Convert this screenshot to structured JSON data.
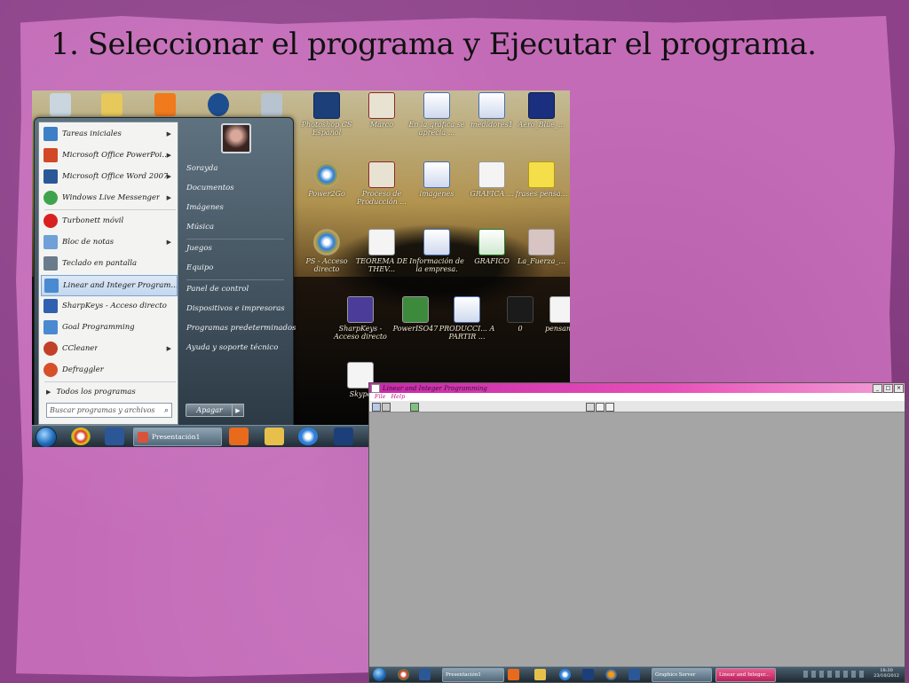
{
  "slide": {
    "title": "1. Seleccionar el programa y Ejecutar el programa."
  },
  "desktop_icons": [
    {
      "label": "Photoshop CS Español",
      "icon": "photoshop-icon"
    },
    {
      "label": "Marco",
      "icon": "pdf-icon"
    },
    {
      "label": "En la gráfica se aprecia ...",
      "icon": "word-doc-icon"
    },
    {
      "label": "medidores1",
      "icon": "word-doc-icon"
    },
    {
      "label": "Aero_Blue_...",
      "icon": "image-icon"
    },
    {
      "label": "Power2Go",
      "icon": "cd-icon"
    },
    {
      "label": "Proceso de Producción ...",
      "icon": "pdf-icon"
    },
    {
      "label": "imagenes",
      "icon": "word-doc-icon"
    },
    {
      "label": "GRAFICA ...",
      "icon": "document-icon"
    },
    {
      "label": "frases pensa...",
      "icon": "note-icon"
    },
    {
      "label": "PS - Acceso directo",
      "icon": "shortcut-icon"
    },
    {
      "label": "TEOREMA DE THEV...",
      "icon": "document-icon"
    },
    {
      "label": "Información de la empresa.",
      "icon": "word-doc-icon"
    },
    {
      "label": "GRAFICO",
      "icon": "excel-icon"
    },
    {
      "label": "La_Fuerza_...",
      "icon": "image-icon"
    },
    {
      "label": "SharpKeys - Acceso directo",
      "icon": "shortcut-icon"
    },
    {
      "label": "PowerISO47",
      "icon": "installer-icon"
    },
    {
      "label": "PRODUCCI... A PARTIR ...",
      "icon": "word-doc-icon"
    },
    {
      "label": "0",
      "icon": "document-icon"
    },
    {
      "label": "pensamientos...",
      "icon": "note-icon"
    },
    {
      "label": "Skype",
      "icon": "document-icon"
    }
  ],
  "start_menu": {
    "programs": [
      {
        "label": "Tareas iniciales",
        "has_submenu": true,
        "color": "#3f7fc6"
      },
      {
        "label": "Microsoft Office PowerPoi...",
        "has_submenu": true,
        "color": "#d24726"
      },
      {
        "label": "Microsoft Office Word 2007",
        "has_submenu": true,
        "color": "#2b5797"
      },
      {
        "label": "Windows Live Messenger",
        "has_submenu": true,
        "color": "#3fa34d"
      },
      {
        "label": "Turbonett móvil",
        "has_submenu": false,
        "color": "#d92020"
      },
      {
        "label": "Bloc de notas",
        "has_submenu": true,
        "color": "#6fa0d8"
      },
      {
        "label": "Teclado en pantalla",
        "has_submenu": false,
        "color": "#6a7c8c"
      },
      {
        "label": "Linear and Integer Program...",
        "has_submenu": false,
        "color": "#4a8ad0",
        "highlighted": true
      },
      {
        "label": "SharpKeys - Acceso directo",
        "has_submenu": false,
        "color": "#3060b0"
      },
      {
        "label": "Goal Programming",
        "has_submenu": false,
        "color": "#4a8ad0"
      },
      {
        "label": "CCleaner",
        "has_submenu": true,
        "color": "#c2402a"
      },
      {
        "label": "Defraggler",
        "has_submenu": false,
        "color": "#d6502a"
      }
    ],
    "all_programs": "Todos los programas",
    "search_placeholder": "Buscar programas y archivos",
    "right_items": [
      "Sorayda",
      "Documentos",
      "Imágenes",
      "Música",
      "Juegos",
      "Equipo",
      "Panel de control",
      "Dispositivos e impresoras",
      "Programas predeterminados",
      "Ayuda y soporte técnico"
    ],
    "shutdown_label": "Apagar"
  },
  "desktop_taskbar": {
    "task_label": "Presentación1"
  },
  "app_window": {
    "title": "Linear and Integer Programming",
    "menu": [
      "File",
      "Help"
    ],
    "taskbar": {
      "tasks": [
        "Presentación1",
        "Graphics Server",
        "Linear and Integer..."
      ],
      "clock_time": "18:30",
      "clock_date": "23/10/2012"
    }
  }
}
